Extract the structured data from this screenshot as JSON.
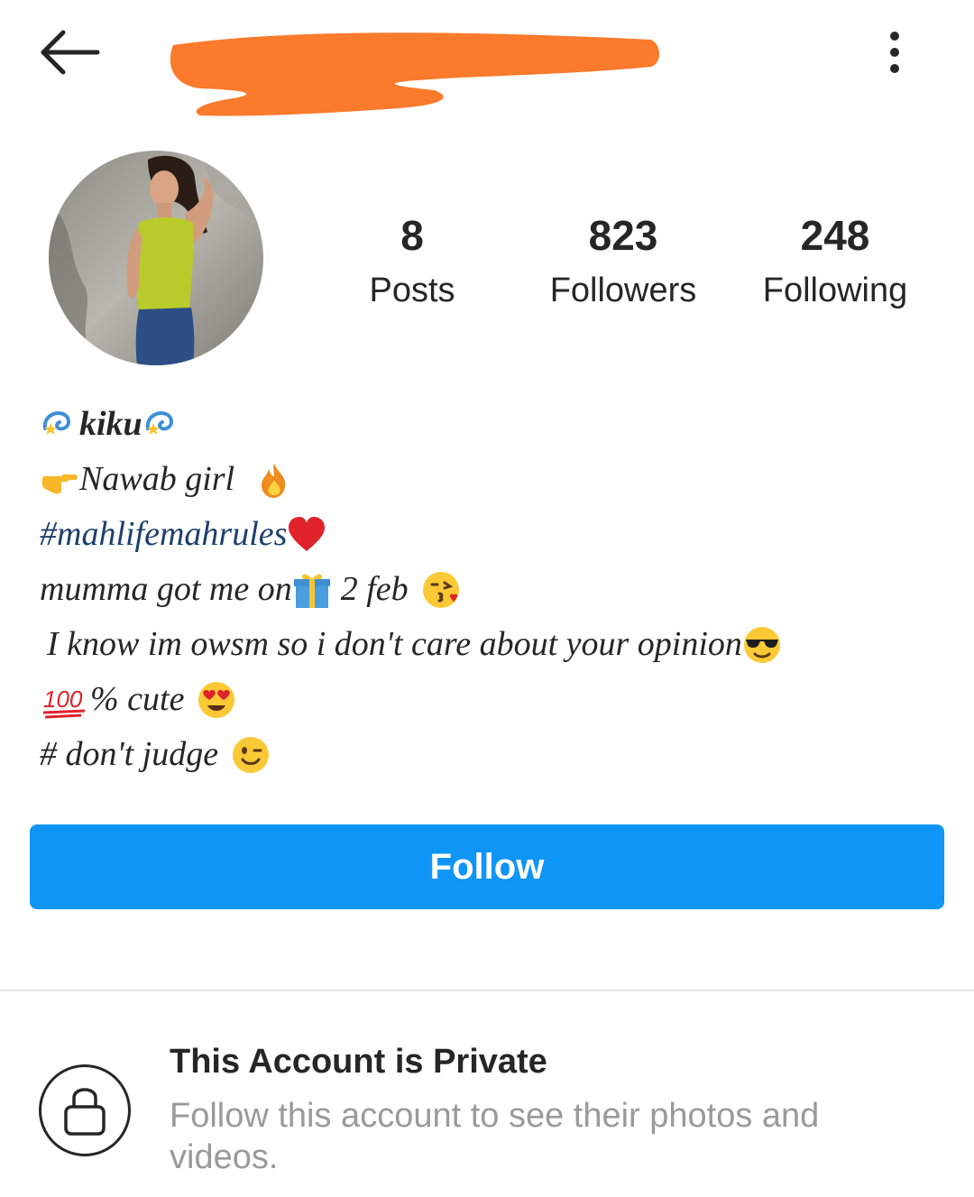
{
  "header": {
    "back_icon": "arrow-left-icon",
    "username_redacted": true,
    "more_icon": "more-vertical-icon"
  },
  "profile": {
    "avatar": "profile-photo"
  },
  "stats": {
    "posts_count": "8",
    "posts_label": "Posts",
    "followers_count": "823",
    "followers_label": "Followers",
    "following_count": "248",
    "following_label": "Following"
  },
  "bio": {
    "name": "kiku",
    "line2": "Nawab girl",
    "hashtag": "#mahlifemahrules",
    "line4a": "mumma got me on",
    "line4b": "2 feb",
    "line5": "I know im owsm so i don't care about your opinion",
    "line6": "% cute",
    "line7": "# don't judge",
    "emojis": [
      "dizzy-icon",
      "pointing-right-icon",
      "fire-icon",
      "red-heart-icon",
      "gift-icon",
      "kiss-face-icon",
      "sunglasses-face-icon",
      "hundred-points-icon",
      "heart-eyes-icon",
      "wink-face-icon"
    ]
  },
  "actions": {
    "follow_label": "Follow"
  },
  "private": {
    "title": "This Account is Private",
    "subtitle": "Follow this account to see their photos and videos.",
    "icon": "lock-icon"
  },
  "colors": {
    "follow_button": "#0f95f6",
    "redaction": "#fb7a2b",
    "hashtag": "#1e3f6d"
  }
}
